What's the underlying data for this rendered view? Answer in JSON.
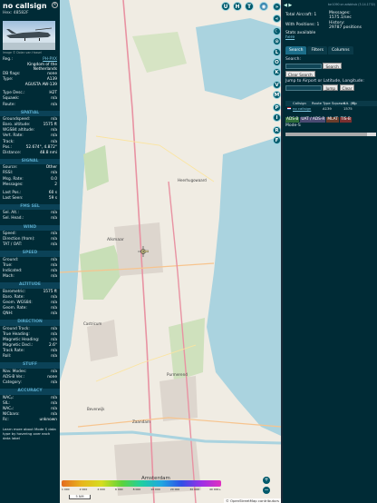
{
  "info": {
    "callsign": "no callsign",
    "hex_label": "Hex:",
    "hex": "48582F",
    "photo_credit": "Image © Dolan van Hassel",
    "registration": {
      "label": "Reg.:",
      "value": "PH-PXX"
    },
    "country": "Kingdom of the Netherlands",
    "db_flags": {
      "label": "DB flags:",
      "value": "none"
    },
    "type": {
      "label": "Type:",
      "value": "A139"
    },
    "type_name": "AGUSTA AW-139",
    "type_desc": {
      "label": "Type Desc.:",
      "value": "H2T"
    },
    "squawk": {
      "label": "Squawk:",
      "value": "n/a"
    },
    "route": {
      "label": "Route:",
      "value": "n/a"
    },
    "spatial_title": "SPATIAL",
    "groundspeed": {
      "label": "Groundspeed:",
      "value": "n/a"
    },
    "baro_alt": {
      "label": "Baro. altitude:",
      "value": "1575 ft"
    },
    "wgs84_alt": {
      "label": "WGS84 altitude:",
      "value": "n/a"
    },
    "vert_rate": {
      "label": "Vert. Rate:",
      "value": "n/a"
    },
    "track": {
      "label": "Track:",
      "value": "n/a"
    },
    "pos": {
      "label": "Pos.:",
      "value": "52.674°, 4.872°"
    },
    "distance": {
      "label": "Distance:",
      "value": "48.8 nmi"
    },
    "signal_title": "SIGNAL",
    "source": {
      "label": "Source:",
      "value": "Other"
    },
    "rssi": {
      "label": "RSSI:",
      "value": "n/a"
    },
    "msg_rate": {
      "label": "Msg. Rate:",
      "value": "0.0"
    },
    "messages": {
      "label": "Messages:",
      "value": "2"
    },
    "last_pos": {
      "label": "Last Pos.:",
      "value": "60 s"
    },
    "last_seen": {
      "label": "Last Seen:",
      "value": "59 s"
    },
    "fms_title": "FMS SEL",
    "sel_alt": {
      "label": "Sel. Alt.:",
      "value": "n/a"
    },
    "sel_head": {
      "label": "Sel. Head.:",
      "value": "n/a"
    },
    "wind_title": "WIND",
    "wind_speed": {
      "label": "Speed:",
      "value": "n/a"
    },
    "wind_dir": {
      "label": "Direction (from):",
      "value": "n/a"
    },
    "oat_tat": {
      "label": "TAT / OAT:",
      "value": "n/a"
    },
    "speed_title": "SPEED",
    "sp_ground": {
      "label": "Ground:",
      "value": "n/a"
    },
    "sp_true": {
      "label": "True:",
      "value": "n/a"
    },
    "sp_indicated": {
      "label": "Indicated:",
      "value": "n/a"
    },
    "sp_mach": {
      "label": "Mach:",
      "value": "n/a"
    },
    "altitude_title": "ALTITUDE",
    "barometric": {
      "label": "Barometric:",
      "value": "1575 ft"
    },
    "baro_rate": {
      "label": "Baro. Rate:",
      "value": "n/a"
    },
    "geom_wgs84": {
      "label": "Geom. WGS84:",
      "value": "n/a"
    },
    "geom_rate": {
      "label": "Geom. Rate:",
      "value": "n/a"
    },
    "qnh": {
      "label": "QNH:",
      "value": "n/a"
    },
    "direction_title": "DIRECTION",
    "ground_track": {
      "label": "Ground Track:",
      "value": "n/a"
    },
    "true_heading": {
      "label": "True Heading:",
      "value": "n/a"
    },
    "mag_heading": {
      "label": "Magnetic Heading:",
      "value": "n/a"
    },
    "mag_decl": {
      "label": "Magnetic Decl.:",
      "value": "2.6°"
    },
    "track_rate": {
      "label": "Track Rate:",
      "value": "n/a"
    },
    "roll": {
      "label": "Roll:",
      "value": "n/a"
    },
    "stuff_title": "STUFF",
    "nav_modes": {
      "label": "Nav. Modes:",
      "value": "n/a"
    },
    "adsb_ver": {
      "label": "ADS-B Ver.:",
      "value": "none"
    },
    "category": {
      "label": "Category:",
      "value": "n/a"
    },
    "accuracy_title": "ACCURACY",
    "nac_p": {
      "label": "NACₚ:",
      "value": "n/a"
    },
    "sil": {
      "label": "SIL:",
      "value": "n/a"
    },
    "nac_v": {
      "label": "NACᵥ:",
      "value": "n/a"
    },
    "nic_baro": {
      "label": "NICbaro:",
      "value": "n/a"
    },
    "rc": {
      "label": "Rc:",
      "value": "unknown"
    },
    "footer": "Learn more about Mode S data type by hovering over each data label"
  },
  "map": {
    "top_buttons": [
      "U",
      "H",
      "T"
    ],
    "town_labels": [
      "Alkmaar",
      "Heerhugowaard",
      "Zaandam",
      "Amsterdam",
      "Castricum",
      "Purmerend",
      "Beverwijk"
    ],
    "scale_label": "5 NM",
    "altitude_ticks": [
      "1 000",
      "2 000",
      "4 000",
      "6 000",
      "8 000",
      "10 000",
      "20 000",
      "30 000",
      "40 000+"
    ],
    "attribution": "© OpenStreetMap contributors",
    "zoom_in": "+",
    "zoom_out": "−"
  },
  "strip": {
    "buttons": [
      "«",
      "»",
      "☾",
      "⊙",
      "L",
      "O",
      "K",
      "V",
      "M",
      "P",
      "I",
      "R",
      "F"
    ]
  },
  "sidebar": {
    "toggle": "◀ ▶",
    "version": "tar1090 on adsbhub (3.14.1732)",
    "total_aircraft_label": "Total Aircraft:",
    "total_aircraft": "1",
    "messages_label": "Messages:",
    "messages": "1575.1/sec",
    "with_positions_label": "With Positions:",
    "with_positions": "1",
    "history_label": "History:",
    "history": "29787 positions",
    "stats_available": "Stats available",
    "stats_link": "here",
    "tabs": [
      "Search",
      "Filters",
      "Columns"
    ],
    "search_label": "Search:",
    "search_button": "Search",
    "clear_search": "Clear Search",
    "jump_label": "Jump to Airport or Latitude, Longitude:",
    "jump_button": "Jump",
    "clear_button": "Clear",
    "table_headers": [
      "",
      "Callsign",
      "Route",
      "Type",
      "Squawk",
      "Alt. (ft)",
      "Sp"
    ],
    "table_row": [
      "",
      "no callsign",
      "",
      "A139",
      "",
      "1575",
      ""
    ],
    "legend": [
      {
        "label": "ADS-B",
        "color": "#2f6e3a"
      },
      {
        "label": "UAT / ADS-R",
        "color": "#4a4a72"
      },
      {
        "label": "MLAT",
        "color": "#6b3d2b"
      },
      {
        "label": "TIS-B",
        "color": "#7a2f2f"
      }
    ],
    "mode_s": "Mode-S"
  }
}
